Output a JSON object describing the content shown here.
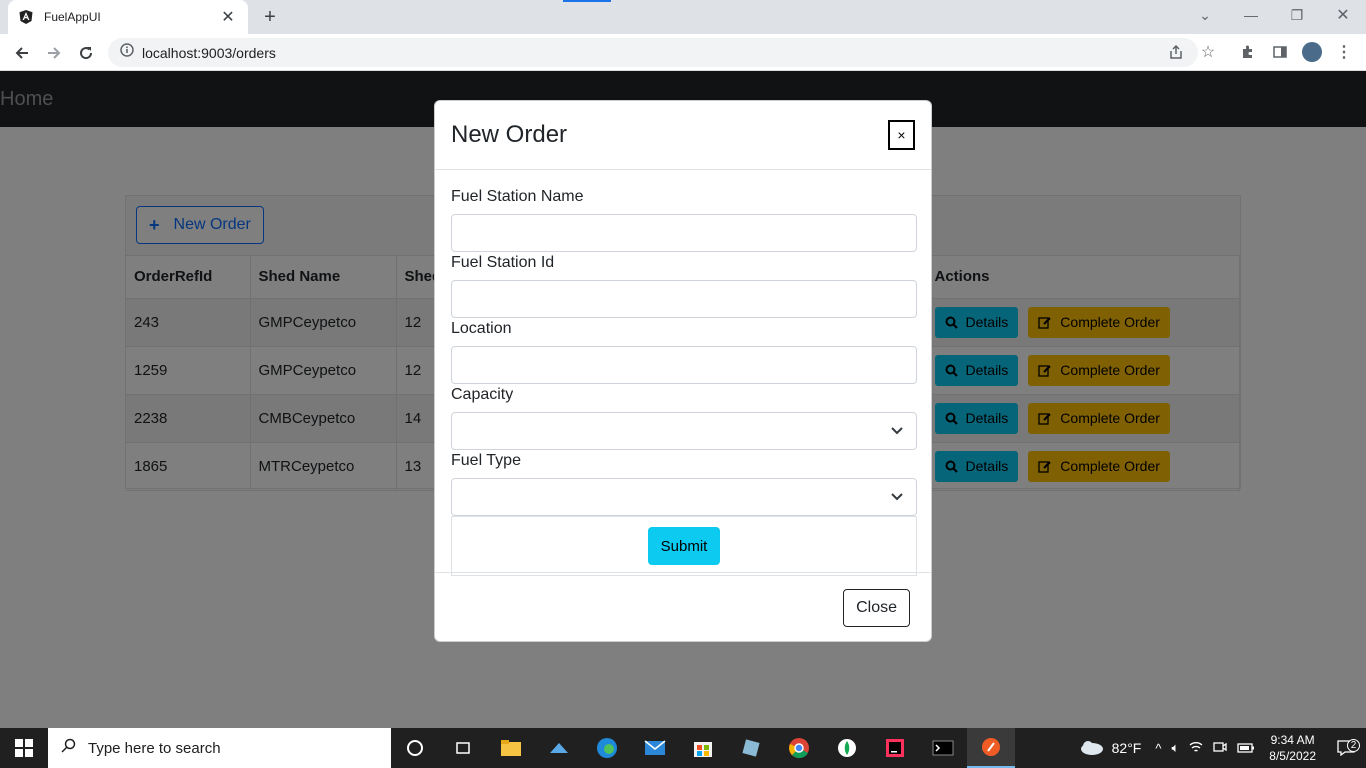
{
  "browser": {
    "tab_title": "FuelAppUI",
    "url": "localhost:9003/orders"
  },
  "navbar": {
    "brand": "Home"
  },
  "toolbar": {
    "new_order_label": "New Order"
  },
  "table": {
    "headers": [
      "OrderRefId",
      "Shed Name",
      "Shed",
      "Actions"
    ],
    "rows": [
      {
        "ref": "243",
        "shed_name": "GMPCeypetco",
        "shed": "12"
      },
      {
        "ref": "1259",
        "shed_name": "GMPCeypetco",
        "shed": "12"
      },
      {
        "ref": "2238",
        "shed_name": "CMBCeypetco",
        "shed": "14"
      },
      {
        "ref": "1865",
        "shed_name": "MTRCeypetco",
        "shed": "13"
      }
    ],
    "details_label": "Details",
    "complete_label": "Complete Order"
  },
  "modal": {
    "title": "New Order",
    "close_x": "×",
    "fields": {
      "station_name": {
        "label": "Fuel Station Name",
        "value": ""
      },
      "station_id": {
        "label": "Fuel Station Id",
        "value": ""
      },
      "location": {
        "label": "Location",
        "value": ""
      },
      "capacity": {
        "label": "Capacity",
        "value": ""
      },
      "fuel_type": {
        "label": "Fuel Type",
        "value": ""
      }
    },
    "submit_label": "Submit",
    "close_label": "Close"
  },
  "taskbar": {
    "search_placeholder": "Type here to search",
    "weather": "82°F",
    "time": "9:34 AM",
    "date": "8/5/2022",
    "notifications": "2"
  }
}
